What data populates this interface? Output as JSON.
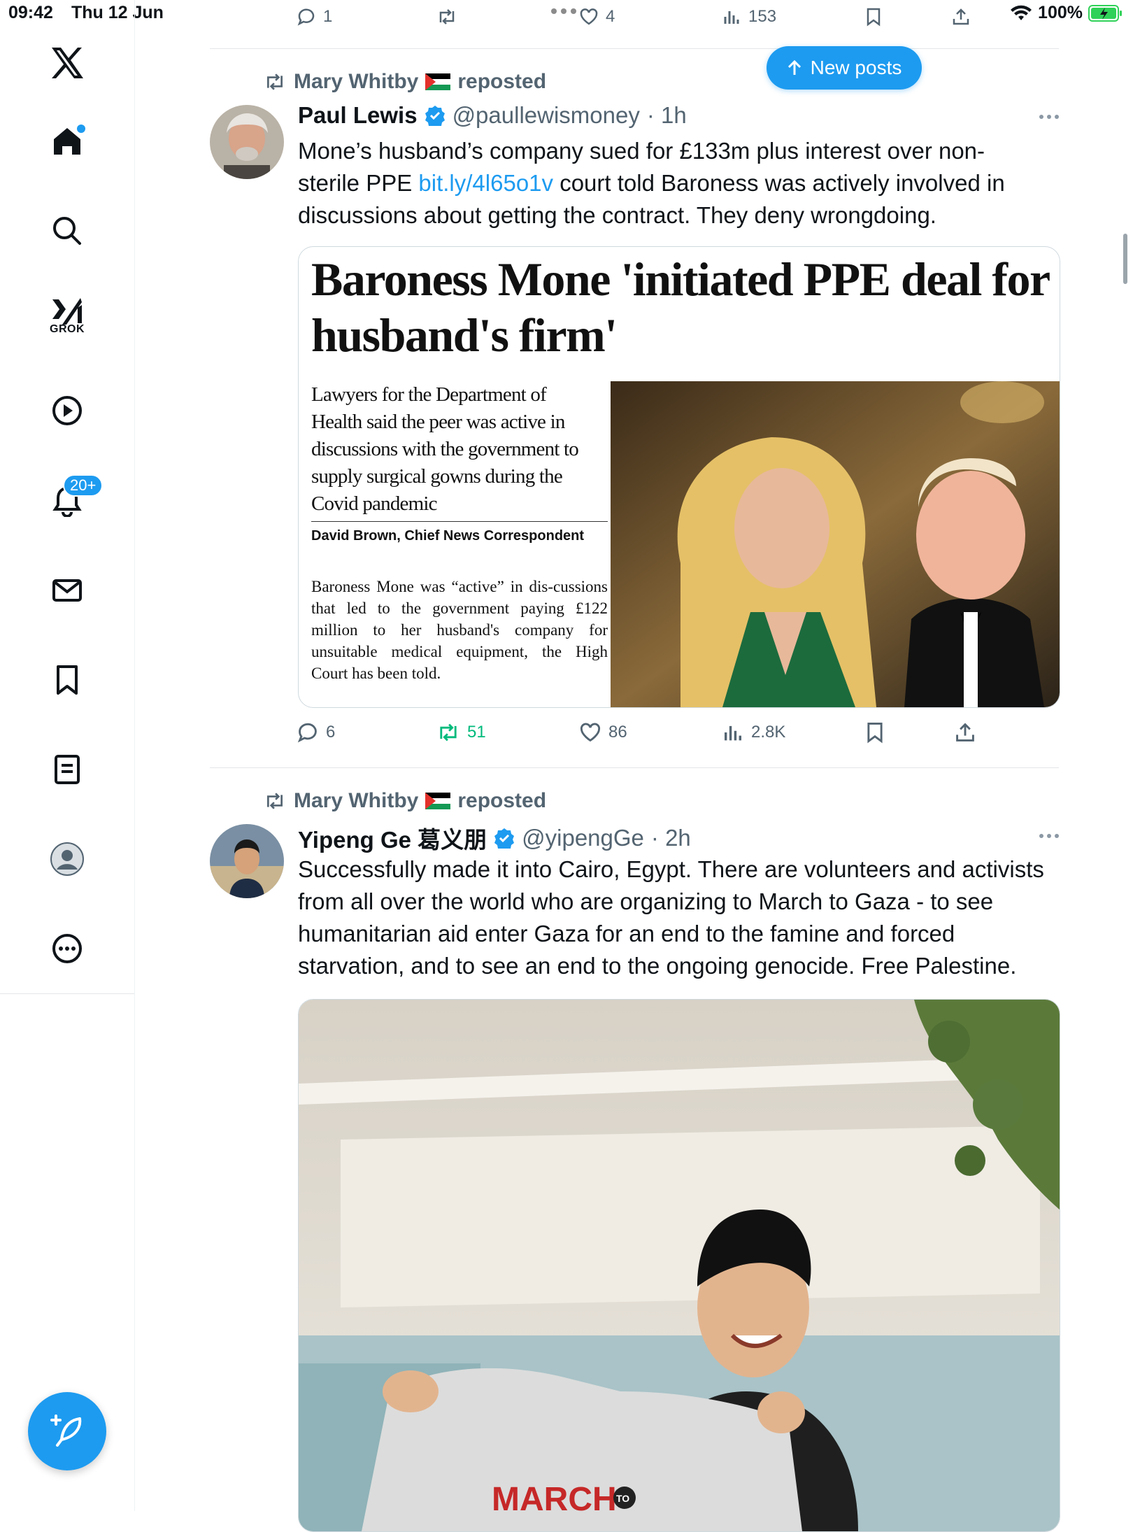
{
  "status_bar": {
    "time": "09:42",
    "date": "Thu 12 Jun",
    "battery": "100%"
  },
  "sidebar": {
    "grok_label": "GROK",
    "notifications_badge": "20+"
  },
  "top_actions": {
    "replies": "1",
    "likes": "4",
    "views": "153"
  },
  "new_posts_label": "New posts",
  "tweets": [
    {
      "repost_by": "Mary Whitby",
      "repost_label": "reposted",
      "name": "Paul Lewis",
      "handle": "@paullewismoney",
      "time": "· 1h",
      "text_before": "Mone’s husband’s company sued for £133m plus interest over non-sterile PPE ",
      "link": "bit.ly/4l65o1v",
      "text_after": " court told Baroness was actively involved in discussions about getting the contract. They deny wrongdoing.",
      "card": {
        "headline": "Baroness Mone 'initiated PPE deal for husband's firm'",
        "subhead": "Lawyers for the Department of Health said the peer was active in discussions with the government to supply surgical gowns during the Covid pandemic",
        "byline": "David Brown, Chief News Correspondent",
        "body": "Baroness Mone was “active” in dis-cussions that led to the government paying £122 million to her husband's company for unsuitable medical equipment, the High Court has been told."
      },
      "actions": {
        "replies": "6",
        "reposts": "51",
        "likes": "86",
        "views": "2.8K"
      }
    },
    {
      "repost_by": "Mary Whitby",
      "repost_label": "reposted",
      "name": "Yipeng Ge 葛义朋",
      "handle": "@yipengGe",
      "time": "· 2h",
      "text": "Successfully made it into Cairo, Egypt. There are volunteers and activists from all over the world who are organizing to March to Gaza - to see humanitarian aid enter Gaza for an end to the famine and forced starvation, and to see an end to the ongoing genocide. Free Palestine.",
      "shirt_text": "MARCH",
      "shirt_small": "TO"
    }
  ],
  "colors": {
    "accent": "#1d9bf0",
    "repost_green": "#00ba7c",
    "muted": "#536471"
  }
}
